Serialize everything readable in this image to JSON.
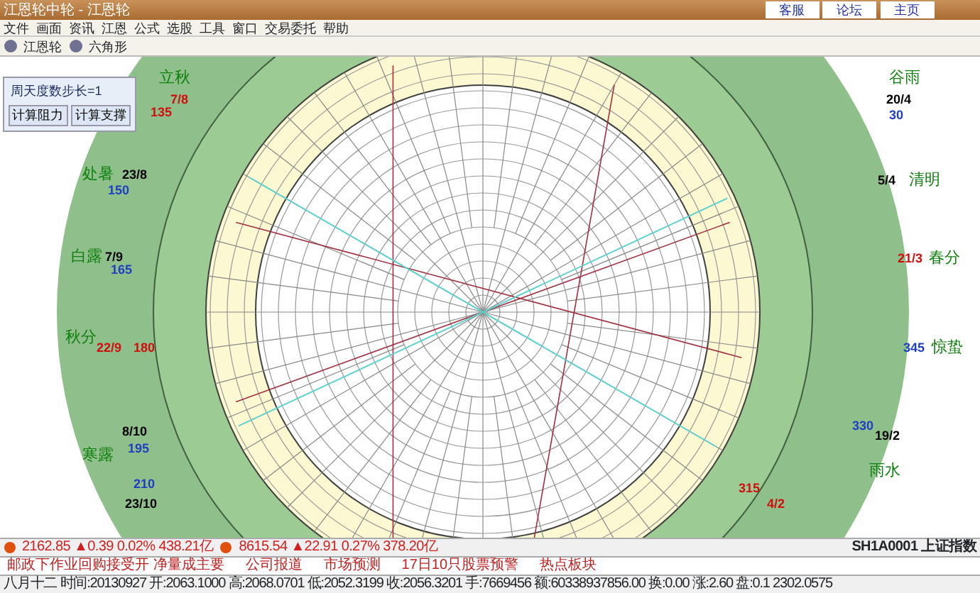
{
  "window": {
    "title": "江恩轮中轮 - 江恩轮",
    "links": [
      "客服",
      "论坛",
      "主页"
    ]
  },
  "menu": [
    "文件",
    "画面",
    "资讯",
    "江恩",
    "公式",
    "选股",
    "工具",
    "窗口",
    "交易委托",
    "帮助"
  ],
  "toolbar": [
    "江恩轮",
    "六角形"
  ],
  "side_panel": {
    "step": "周天度数步长=1",
    "buttons": [
      "计算阻力",
      "计算支撑"
    ]
  },
  "wheel_labels": [
    {
      "term": "谷雨",
      "date": "20/4",
      "degree": "30",
      "color": "#2040c0"
    },
    {
      "term": "清明",
      "date": "5/4",
      "color": "#000000"
    },
    {
      "term": "春分",
      "date": "21/3",
      "color": "#d01010"
    },
    {
      "term": "惊蛰",
      "degree": "345",
      "color": "#2040c0"
    },
    {
      "term": "雨水",
      "date": "19/2",
      "degree": "330",
      "color": "#2040c0"
    },
    {
      "date": "4/2",
      "degree": "315",
      "color": "#d01010"
    },
    {
      "term": "立秋",
      "date": "7/8",
      "degree": "135",
      "color": "#d01010"
    },
    {
      "term": "处暑",
      "date": "23/8",
      "degree": "150",
      "color": "#2040c0"
    },
    {
      "term": "白露",
      "date": "7/9",
      "degree": "165",
      "color": "#2040c0"
    },
    {
      "term": "秋分",
      "date": "22/9",
      "degree": "180",
      "color": "#d01010"
    },
    {
      "term": "寒露",
      "date": "8/10",
      "degree": "195",
      "color": "#2040c0"
    },
    {
      "date": "23/10",
      "degree": "210",
      "color": "#2040c0"
    }
  ],
  "tickers": [
    {
      "price": "2162.85",
      "change": "▲0.39",
      "pct": "0.02%",
      "amount": "438.21亿"
    },
    {
      "price": "8615.54",
      "change": "▲22.91",
      "pct": "0.27%",
      "amount": "378.20亿"
    }
  ],
  "news": [
    "邮政下作业回购接受开 净量成主要",
    "公司报道",
    "市场预测",
    "17日10只股票预警",
    "热点板块"
  ],
  "index_name": "SH1A0001 上证指数",
  "status": "八月十二 时间:20130927 开:2063.1000 高:2068.0701 低:2052.3199 收:2056.3201 手:7669456 额:60338937856.00 换:0.00 涨:2.60 盘:0.1 2302.0575"
}
